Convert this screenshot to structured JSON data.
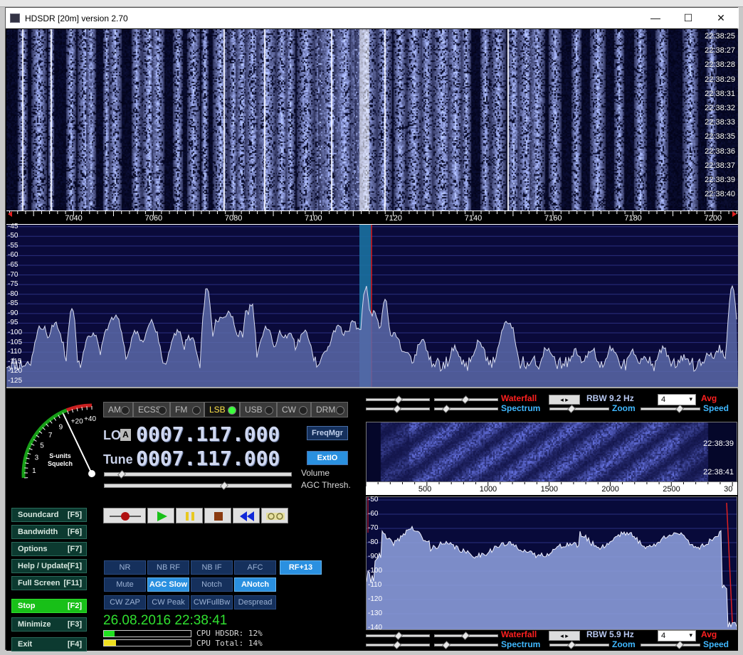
{
  "window": {
    "title": "HDSDR [20m]  version 2.70",
    "controls": {
      "minimize": "—",
      "maximize": "☐",
      "close": "✕"
    }
  },
  "main_waterfall": {
    "timestamps": [
      "22:38:25",
      "22:38:27",
      "22:38:28",
      "22:38:29",
      "22:38:31",
      "22:38:32",
      "22:38:33",
      "22:38:35",
      "22:38:36",
      "22:38:37",
      "22:38:39",
      "22:38:40"
    ],
    "freq_ticks": [
      "7040",
      "7060",
      "7080",
      "7100",
      "7120",
      "7140",
      "7160",
      "7180",
      "7200"
    ]
  },
  "main_spectrum": {
    "db_ticks": [
      "-45",
      "-50",
      "-55",
      "-60",
      "-65",
      "-70",
      "-75",
      "-80",
      "-85",
      "-90",
      "-95",
      "-100",
      "-105",
      "-110",
      "-115",
      "-120",
      "-125"
    ]
  },
  "smeter": {
    "scale": [
      "1",
      "3",
      "5",
      "7",
      "9",
      "+20",
      "+40"
    ],
    "label_line1": "S-units",
    "label_line2": "Squelch"
  },
  "modes": [
    {
      "label": "AM",
      "active": false
    },
    {
      "label": "ECSS",
      "active": false
    },
    {
      "label": "FM",
      "active": false
    },
    {
      "label": "LSB",
      "active": true
    },
    {
      "label": "USB",
      "active": false
    },
    {
      "label": "CW",
      "active": false
    },
    {
      "label": "DRM",
      "active": false
    }
  ],
  "lo": {
    "label": "LO",
    "badge": "A",
    "value": "0007.117.000"
  },
  "tune": {
    "label": "Tune",
    "value": "0007.117.000"
  },
  "buttons": {
    "freqmgr": "FreqMgr",
    "extio": "ExtIO"
  },
  "slider_labels": {
    "volume": "Volume",
    "agc": "AGC Thresh."
  },
  "levels": {
    "volume": 0.09,
    "agc_thresh": 0.64
  },
  "side_buttons": [
    {
      "label": "Soundcard",
      "key": "[F5]"
    },
    {
      "label": "Bandwidth",
      "key": "[F6]"
    },
    {
      "label": "Options",
      "key": "[F7]"
    },
    {
      "label": "Help / Update",
      "key": "[F1]"
    },
    {
      "label": "Full Screen",
      "key": "[F11]"
    },
    {
      "label": "Stop",
      "key": "[F2]"
    },
    {
      "label": "Minimize",
      "key": "[F3]"
    },
    {
      "label": "Exit",
      "key": "[F4]"
    }
  ],
  "dsp_row1": [
    "NR",
    "NB RF",
    "NB IF",
    "AFC",
    "RF+13"
  ],
  "dsp_row2": [
    "Mute",
    "AGC Slow",
    "Notch",
    "ANotch"
  ],
  "dsp_row3": [
    "CW ZAP",
    "CW Peak",
    "CWFullBw",
    "Despread"
  ],
  "active_dsp": [
    "RF+13",
    "AGC Slow",
    "ANotch"
  ],
  "datetime": "26.08.2016 22:38:41",
  "cpu": {
    "hdsdr_label": "CPU HDSDR:",
    "hdsdr_val": "12%",
    "total_label": "CPU Total:",
    "total_val": "14%",
    "hdsdr_frac": 0.12,
    "total_frac": 0.14
  },
  "rf_panel": {
    "waterfall": "Waterfall",
    "spectrum": "Spectrum",
    "rbw_label": "RBW",
    "rbw_value": "9.2 Hz",
    "zoom": "Zoom",
    "avg": "Avg",
    "speed": "Speed",
    "dropdown": "4"
  },
  "af_panel": {
    "waterfall": "Waterfall",
    "spectrum": "Spectrum",
    "rbw_label": "RBW",
    "rbw_value": "5.9 Hz",
    "zoom": "Zoom",
    "avg": "Avg",
    "speed": "Speed",
    "dropdown": "4"
  },
  "af_waterfall": {
    "timestamps": [
      "22:38:39",
      "22:38:41"
    ],
    "freq_ticks": [
      "500",
      "1000",
      "1500",
      "2000",
      "2500",
      "30"
    ]
  },
  "af_spectrum": {
    "db_ticks": [
      "-50",
      "-60",
      "-70",
      "-80",
      "-90",
      "-100",
      "-110",
      "-120",
      "-130",
      "-140"
    ]
  },
  "colors": {
    "accent_blue": "#2a90e0",
    "wf_base": "#04061c",
    "spectrum_fill": "#6a7ab8",
    "af_spectrum_fill": "#9aaae0",
    "stop_green": "#18c018",
    "led_green": "#3cff3c"
  }
}
